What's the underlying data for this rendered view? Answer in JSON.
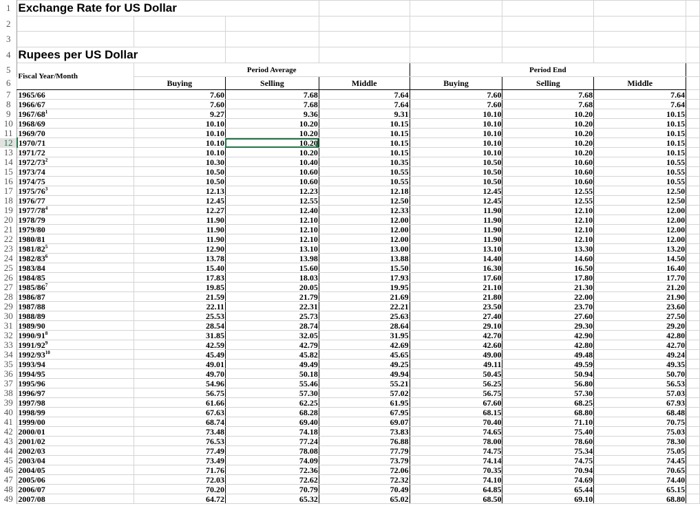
{
  "title": "Exchange Rate for US Dollar",
  "subtitle": "Rupees per US Dollar",
  "headers": {
    "fiscal": "Fiscal Year/Month",
    "period_average": "Period Average",
    "period_end": "Period End",
    "buying": "Buying",
    "selling": "Selling",
    "middle": "Middle"
  },
  "row_numbers": [
    "1",
    "2",
    "3",
    "4",
    "5",
    "6"
  ],
  "selected_cell": {
    "row": 12,
    "column": "C"
  },
  "rows": [
    {
      "year": "1965/66",
      "note": "",
      "avg": [
        "7.60",
        "7.68",
        "7.64"
      ],
      "end": [
        "7.60",
        "7.68",
        "7.64"
      ]
    },
    {
      "year": "1966/67",
      "note": "",
      "avg": [
        "7.60",
        "7.68",
        "7.64"
      ],
      "end": [
        "7.60",
        "7.68",
        "7.64"
      ]
    },
    {
      "year": "1967/68",
      "note": "1",
      "avg": [
        "9.27",
        "9.36",
        "9.31"
      ],
      "end": [
        "10.10",
        "10.20",
        "10.15"
      ]
    },
    {
      "year": "1968/69",
      "note": "",
      "avg": [
        "10.10",
        "10.20",
        "10.15"
      ],
      "end": [
        "10.10",
        "10.20",
        "10.15"
      ]
    },
    {
      "year": "1969/70",
      "note": "",
      "avg": [
        "10.10",
        "10.20",
        "10.15"
      ],
      "end": [
        "10.10",
        "10.20",
        "10.15"
      ]
    },
    {
      "year": "1970/71",
      "note": "",
      "avg": [
        "10.10",
        "10.20",
        "10.15"
      ],
      "end": [
        "10.10",
        "10.20",
        "10.15"
      ]
    },
    {
      "year": "1971/72",
      "note": "",
      "avg": [
        "10.10",
        "10.20",
        "10.15"
      ],
      "end": [
        "10.10",
        "10.20",
        "10.15"
      ]
    },
    {
      "year": "1972/73",
      "note": "2",
      "avg": [
        "10.30",
        "10.40",
        "10.35"
      ],
      "end": [
        "10.50",
        "10.60",
        "10.55"
      ]
    },
    {
      "year": "1973/74",
      "note": "",
      "avg": [
        "10.50",
        "10.60",
        "10.55"
      ],
      "end": [
        "10.50",
        "10.60",
        "10.55"
      ]
    },
    {
      "year": "1974/75",
      "note": "",
      "avg": [
        "10.50",
        "10.60",
        "10.55"
      ],
      "end": [
        "10.50",
        "10.60",
        "10.55"
      ]
    },
    {
      "year": "1975/76",
      "note": "3",
      "avg": [
        "12.13",
        "12.23",
        "12.18"
      ],
      "end": [
        "12.45",
        "12.55",
        "12.50"
      ]
    },
    {
      "year": "1976/77",
      "note": "",
      "avg": [
        "12.45",
        "12.55",
        "12.50"
      ],
      "end": [
        "12.45",
        "12.55",
        "12.50"
      ]
    },
    {
      "year": "1977/78",
      "note": "4",
      "avg": [
        "12.27",
        "12.40",
        "12.33"
      ],
      "end": [
        "11.90",
        "12.10",
        "12.00"
      ]
    },
    {
      "year": "1978/79",
      "note": "",
      "avg": [
        "11.90",
        "12.10",
        "12.00"
      ],
      "end": [
        "11.90",
        "12.10",
        "12.00"
      ]
    },
    {
      "year": "1979/80",
      "note": "",
      "avg": [
        "11.90",
        "12.10",
        "12.00"
      ],
      "end": [
        "11.90",
        "12.10",
        "12.00"
      ]
    },
    {
      "year": "1980/81",
      "note": "",
      "avg": [
        "11.90",
        "12.10",
        "12.00"
      ],
      "end": [
        "11.90",
        "12.10",
        "12.00"
      ]
    },
    {
      "year": "1981/82",
      "note": "5",
      "avg": [
        "12.90",
        "13.10",
        "13.00"
      ],
      "end": [
        "13.10",
        "13.30",
        "13.20"
      ]
    },
    {
      "year": "1982/83",
      "note": "6",
      "avg": [
        "13.78",
        "13.98",
        "13.88"
      ],
      "end": [
        "14.40",
        "14.60",
        "14.50"
      ]
    },
    {
      "year": "1983/84",
      "note": "",
      "avg": [
        "15.40",
        "15.60",
        "15.50"
      ],
      "end": [
        "16.30",
        "16.50",
        "16.40"
      ]
    },
    {
      "year": "1984/85",
      "note": "",
      "avg": [
        "17.83",
        "18.03",
        "17.93"
      ],
      "end": [
        "17.60",
        "17.80",
        "17.70"
      ]
    },
    {
      "year": "1985/86",
      "note": "7",
      "avg": [
        "19.85",
        "20.05",
        "19.95"
      ],
      "end": [
        "21.10",
        "21.30",
        "21.20"
      ]
    },
    {
      "year": "1986/87",
      "note": "",
      "avg": [
        "21.59",
        "21.79",
        "21.69"
      ],
      "end": [
        "21.80",
        "22.00",
        "21.90"
      ]
    },
    {
      "year": "1987/88",
      "note": "",
      "avg": [
        "22.11",
        "22.31",
        "22.21"
      ],
      "end": [
        "23.50",
        "23.70",
        "23.60"
      ]
    },
    {
      "year": "1988/89",
      "note": "",
      "avg": [
        "25.53",
        "25.73",
        "25.63"
      ],
      "end": [
        "27.40",
        "27.60",
        "27.50"
      ]
    },
    {
      "year": "1989/90",
      "note": "",
      "avg": [
        "28.54",
        "28.74",
        "28.64"
      ],
      "end": [
        "29.10",
        "29.30",
        "29.20"
      ]
    },
    {
      "year": "1990/91",
      "note": "8",
      "avg": [
        "31.85",
        "32.05",
        "31.95"
      ],
      "end": [
        "42.70",
        "42.90",
        "42.80"
      ]
    },
    {
      "year": "1991/92",
      "note": "9",
      "avg": [
        "42.59",
        "42.79",
        "42.69"
      ],
      "end": [
        "42.60",
        "42.80",
        "42.70"
      ]
    },
    {
      "year": "1992/93",
      "note": "10",
      "avg": [
        "45.49",
        "45.82",
        "45.65"
      ],
      "end": [
        "49.00",
        "49.48",
        "49.24"
      ]
    },
    {
      "year": "1993/94",
      "note": "",
      "avg": [
        "49.01",
        "49.49",
        "49.25"
      ],
      "end": [
        "49.11",
        "49.59",
        "49.35"
      ]
    },
    {
      "year": "1994/95",
      "note": "",
      "avg": [
        "49.70",
        "50.18",
        "49.94"
      ],
      "end": [
        "50.45",
        "50.94",
        "50.70"
      ]
    },
    {
      "year": "1995/96",
      "note": "",
      "avg": [
        "54.96",
        "55.46",
        "55.21"
      ],
      "end": [
        "56.25",
        "56.80",
        "56.53"
      ]
    },
    {
      "year": "1996/97",
      "note": "",
      "avg": [
        "56.75",
        "57.30",
        "57.02"
      ],
      "end": [
        "56.75",
        "57.30",
        "57.03"
      ]
    },
    {
      "year": "1997/98",
      "note": "",
      "avg": [
        "61.66",
        "62.25",
        "61.95"
      ],
      "end": [
        "67.60",
        "68.25",
        "67.93"
      ]
    },
    {
      "year": "1998/99",
      "note": "",
      "avg": [
        "67.63",
        "68.28",
        "67.95"
      ],
      "end": [
        "68.15",
        "68.80",
        "68.48"
      ]
    },
    {
      "year": "1999/00",
      "note": "",
      "avg": [
        "68.74",
        "69.40",
        "69.07"
      ],
      "end": [
        "70.40",
        "71.10",
        "70.75"
      ]
    },
    {
      "year": "2000/01",
      "note": "",
      "avg": [
        "73.48",
        "74.18",
        "73.83"
      ],
      "end": [
        "74.65",
        "75.40",
        "75.03"
      ]
    },
    {
      "year": "2001/02",
      "note": "",
      "avg": [
        "76.53",
        "77.24",
        "76.88"
      ],
      "end": [
        "78.00",
        "78.60",
        "78.30"
      ]
    },
    {
      "year": "2002/03",
      "note": "",
      "avg": [
        "77.49",
        "78.08",
        "77.79"
      ],
      "end": [
        "74.75",
        "75.34",
        "75.05"
      ]
    },
    {
      "year": "2003/04",
      "note": "",
      "avg": [
        "73.49",
        "74.09",
        "73.79"
      ],
      "end": [
        "74.14",
        "74.75",
        "74.45"
      ]
    },
    {
      "year": "2004/05",
      "note": "",
      "avg": [
        "71.76",
        "72.36",
        "72.06"
      ],
      "end": [
        "70.35",
        "70.94",
        "70.65"
      ]
    },
    {
      "year": "2005/06",
      "note": "",
      "avg": [
        "72.03",
        "72.62",
        "72.32"
      ],
      "end": [
        "74.10",
        "74.69",
        "74.40"
      ]
    },
    {
      "year": "2006/07",
      "note": "",
      "avg": [
        "70.20",
        "70.79",
        "70.49"
      ],
      "end": [
        "64.85",
        "65.44",
        "65.15"
      ]
    },
    {
      "year": "2007/08",
      "note": "",
      "avg": [
        "64.72",
        "65.32",
        "65.02"
      ],
      "end": [
        "68.50",
        "69.10",
        "68.80"
      ]
    }
  ]
}
